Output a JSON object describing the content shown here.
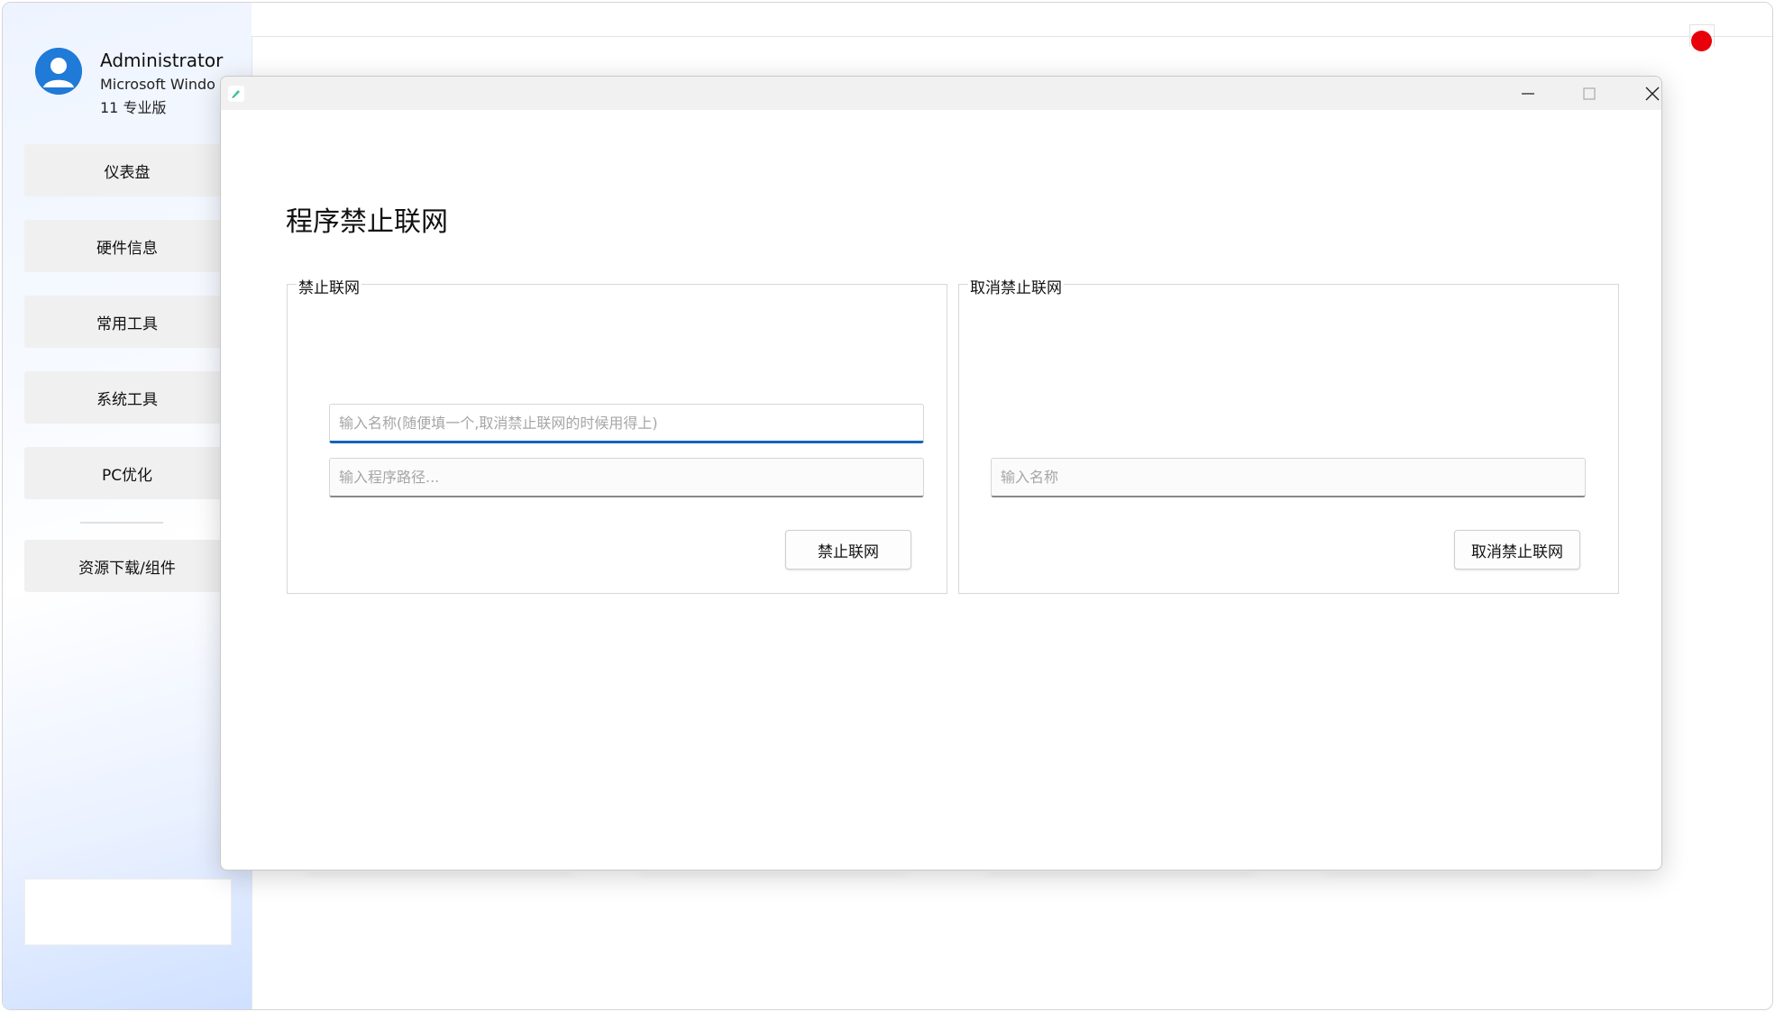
{
  "user": {
    "name": "Administrator",
    "os_line1": "Microsoft Windo",
    "os_line2": "11 专业版"
  },
  "sidebar": {
    "items": [
      {
        "label": "仪表盘"
      },
      {
        "label": "硬件信息"
      },
      {
        "label": "常用工具"
      },
      {
        "label": "系统工具"
      },
      {
        "label": "PC优化"
      },
      {
        "label": "资源下载/组件"
      }
    ]
  },
  "dialog": {
    "title": "程序禁止联网",
    "block_group": {
      "legend": "禁止联网",
      "name_placeholder": "输入名称(随便填一个,取消禁止联网的时候用得上)",
      "path_placeholder": "输入程序路径...",
      "button_label": "禁止联网"
    },
    "unblock_group": {
      "legend": "取消禁止联网",
      "name_placeholder": "输入名称",
      "button_label": "取消禁止联网"
    }
  },
  "colors": {
    "accent": "#1463b8",
    "notification": "#e8000a",
    "avatar": "#1f7ad8"
  }
}
